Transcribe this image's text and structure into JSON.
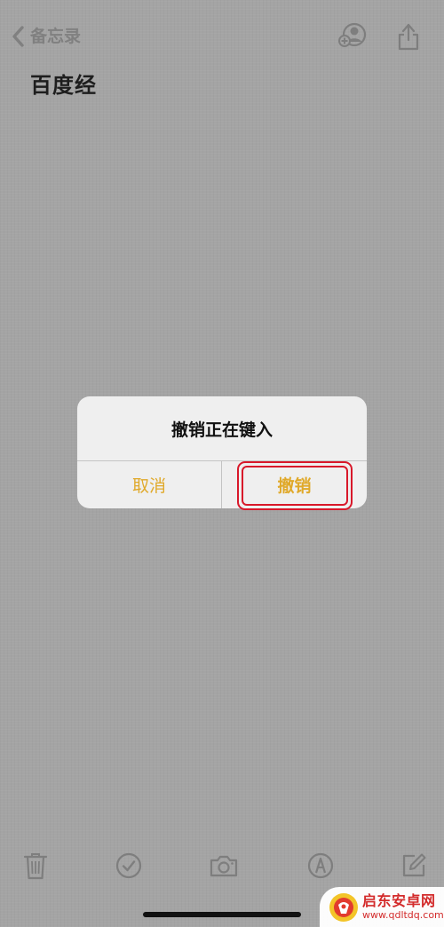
{
  "nav": {
    "back_label": "备忘录",
    "back_icon": "chevron-left-icon",
    "share_person_icon": "add-person-icon",
    "share_icon": "share-icon"
  },
  "note": {
    "title": "百度经"
  },
  "alert": {
    "title": "撤销正在键入",
    "cancel_label": "取消",
    "confirm_label": "撤销"
  },
  "toolbar": {
    "items": [
      {
        "name": "trash-icon"
      },
      {
        "name": "checklist-icon"
      },
      {
        "name": "camera-icon"
      },
      {
        "name": "markup-icon"
      },
      {
        "name": "compose-icon"
      }
    ]
  },
  "watermark": {
    "name": "启东安卓网",
    "url": "www.qdltdq.com"
  },
  "colors": {
    "background": "#a4a4a4",
    "accent": "#e0a92a",
    "highlight": "#d8182a",
    "alert_bg": "#efefef"
  }
}
